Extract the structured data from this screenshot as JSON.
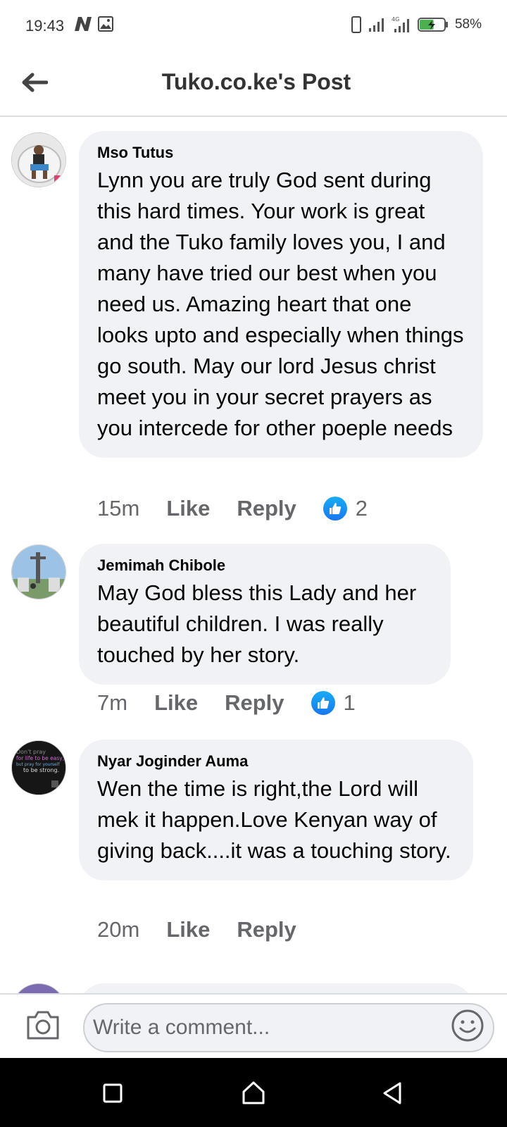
{
  "status_bar": {
    "time": "19:43",
    "battery_percent": "58%",
    "battery_level": 0.58,
    "left_icons": [
      "n-app-icon",
      "image-icon"
    ],
    "right_icons": [
      "phone-icon",
      "signal-icon",
      "signal-icon",
      "battery-icon"
    ]
  },
  "header": {
    "title": "Tuko.co.ke's Post"
  },
  "comments": [
    {
      "author": "Mso Tutus",
      "text": "Lynn you are truly God sent during this hard times. Your work is great and the Tuko family loves you,  I and many have tried our best when you need us. Amazing heart that one looks upto and especially when things go south. May our lord Jesus christ meet you in your secret prayers as you intercede for other poeple needs",
      "time": "15m",
      "like_label": "Like",
      "reply_label": "Reply",
      "reaction_count": "2"
    },
    {
      "author": "Jemimah Chibole",
      "text": "May God bless this Lady and her beautiful children. I was really touched by her story.",
      "time": "7m",
      "like_label": "Like",
      "reply_label": "Reply",
      "reaction_count": "1"
    },
    {
      "author": "Nyar Joginder Auma",
      "text": "Wen the time is right,the Lord will mek it happen.Love Kenyan way of giving back....it was a touching story.",
      "time": "20m",
      "like_label": "Like",
      "reply_label": "Reply",
      "reaction_count": null
    }
  ],
  "avatar_3": {
    "line1": "Don't pray",
    "line2": "for life to be easy,",
    "line3": "but pray for yourself",
    "line4": "to be strong."
  },
  "composer": {
    "placeholder": "Write a comment..."
  },
  "colors": {
    "bubble": "#f0f2f5",
    "accent": "#1877f2",
    "secondary_text": "#65676b"
  }
}
